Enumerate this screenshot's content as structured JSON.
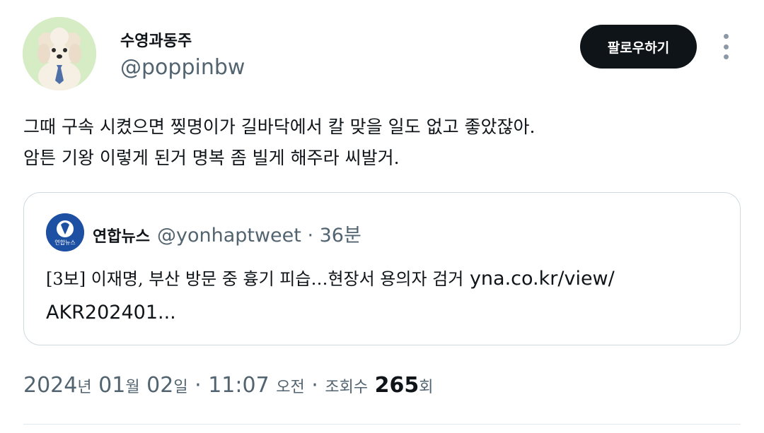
{
  "user": {
    "display_name": "수영과동주",
    "handle": "@poppinbw"
  },
  "actions": {
    "follow_label": "팔로우하기"
  },
  "tweet": {
    "lines": [
      "그때 구속 시켰으면 찢명이가 길바닥에서 칼 맞을 일도 없고 좋았잖아.",
      "암튼 기왕 이렇게 된거 명복 좀 빌게 해주라 씨발거."
    ]
  },
  "quote": {
    "account_name": "연합뉴스",
    "handle": "@yonhaptweet",
    "time": "· 36분",
    "avatar_label": "연합뉴스",
    "text": "[3보] 이재명, 부산 방문 중 흉기 피습…현장서 용의자 검거",
    "link_1": "yna.co.kr/view/",
    "link_2": "AKR202401..."
  },
  "meta": {
    "date_prefix": "2024",
    "year_unit": "년",
    "month": "01",
    "month_unit": "월",
    "day": "02",
    "day_unit": "일",
    "sep1": "·",
    "time": "11:07",
    "ampm": "오전",
    "sep2": "·",
    "views_label": "조회수",
    "views": "265",
    "views_unit": "회"
  },
  "colors": {
    "follow_bg": "#0f1419",
    "secondary_text": "#536471",
    "border": "#cfd9de",
    "quote_avatar_bg": "#1d4fa3"
  }
}
